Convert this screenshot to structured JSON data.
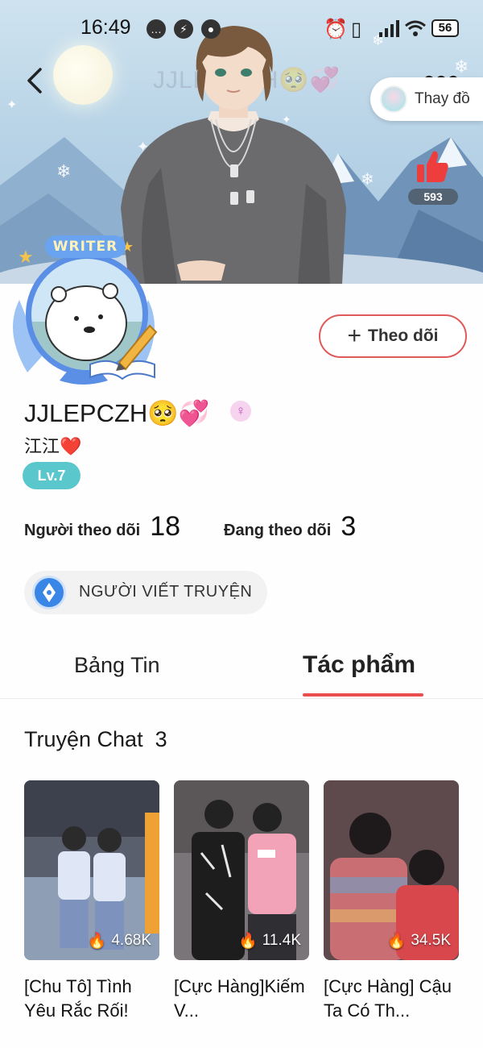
{
  "status_bar": {
    "time": "16:49",
    "battery": "56"
  },
  "header": {
    "watermark": "JJLEPCZH🥺💞",
    "change_label": "Thay đồ",
    "like_count": "593"
  },
  "avatar": {
    "frame_label": "WRITER"
  },
  "follow_button": {
    "label": "Theo dõi"
  },
  "profile": {
    "username": "JJLEPCZH🥺💞",
    "gender_symbol": "♀",
    "nickname": "江江❤️",
    "level": "Lv.7",
    "followers_label": "Người theo dõi",
    "followers_count": "18",
    "following_label": "Đang theo dõi",
    "following_count": "3",
    "role": "NGƯỜI VIẾT TRUYỆN"
  },
  "tabs": [
    {
      "label": "Bảng Tin",
      "active": false
    },
    {
      "label": "Tác phẩm",
      "active": true
    }
  ],
  "section": {
    "title": "Truyện Chat",
    "count": "3"
  },
  "stories": [
    {
      "views": "4.68K",
      "title": "[Chu Tô] Tình Yêu Rắc Rối!"
    },
    {
      "views": "11.4K",
      "title": "[Cực Hàng]Kiếm V..."
    },
    {
      "views": "34.5K",
      "title": "[Cực Hàng] Cậu Ta Có Th..."
    }
  ],
  "colors": {
    "accent": "#ea4d4d",
    "level": "#59c7cc",
    "role_icon": "#3a86e6"
  }
}
